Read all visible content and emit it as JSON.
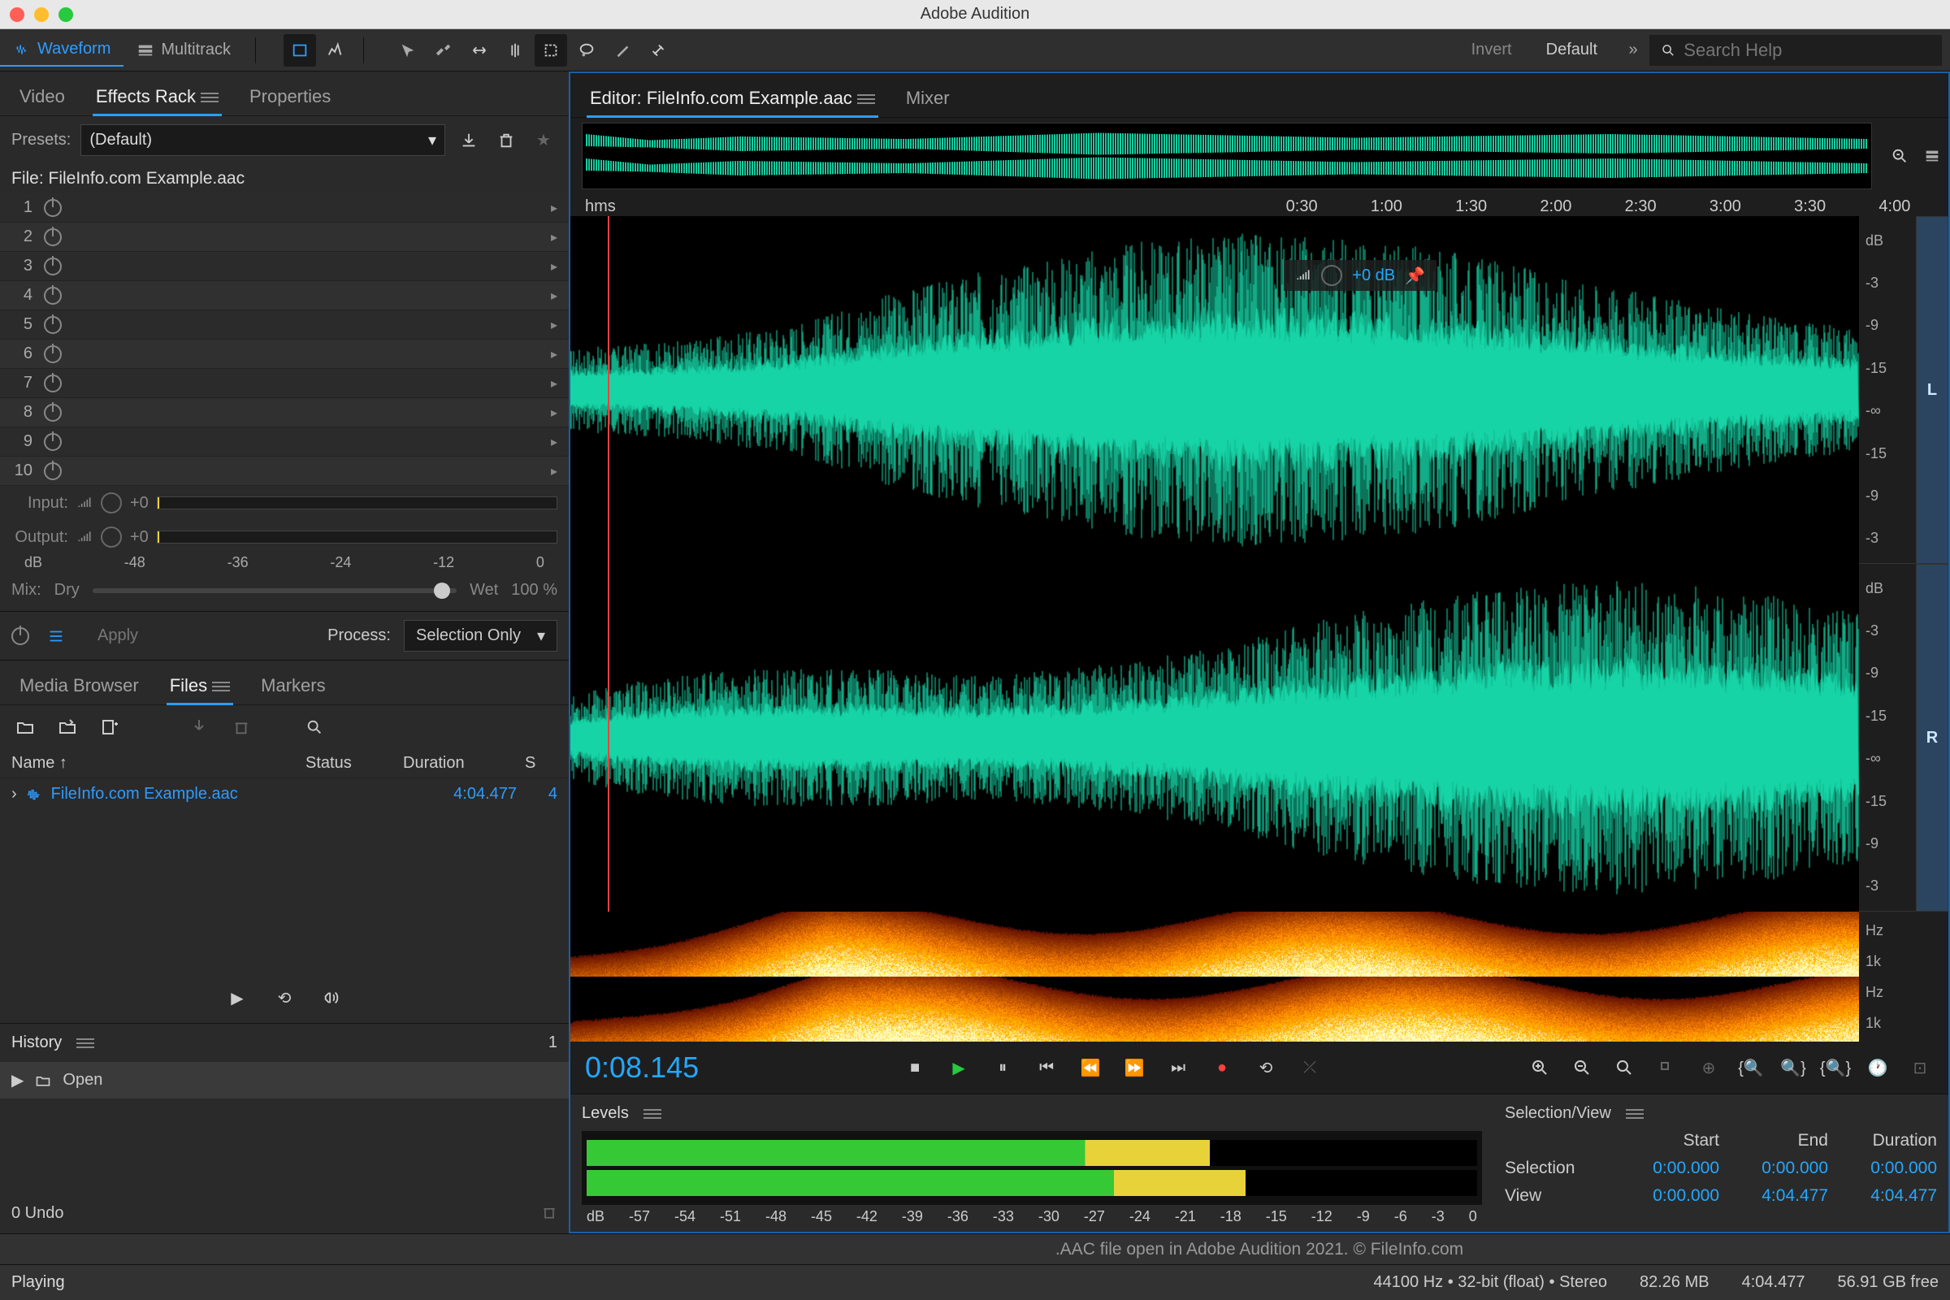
{
  "app": {
    "title": "Adobe Audition"
  },
  "modebar": {
    "waveform": "Waveform",
    "multitrack": "Multitrack",
    "invert": "Invert",
    "workspace": "Default",
    "search_placeholder": "Search Help"
  },
  "left_tabs": {
    "video": "Video",
    "effects": "Effects Rack",
    "properties": "Properties"
  },
  "fx": {
    "presets_label": "Presets:",
    "preset_value": "(Default)",
    "file_label": "File: FileInfo.com Example.aac",
    "slots": [
      1,
      2,
      3,
      4,
      5,
      6,
      7,
      8,
      9,
      10
    ],
    "input_label": "Input:",
    "output_label": "Output:",
    "gain": "+0",
    "db_ticks": [
      "dB",
      "-48",
      "-36",
      "-24",
      "-12",
      "0"
    ],
    "mix_label": "Mix:",
    "dry": "Dry",
    "wet": "Wet",
    "mix_pct": "100 %",
    "apply": "Apply",
    "process_label": "Process:",
    "process_value": "Selection Only"
  },
  "files_tabs": {
    "media": "Media Browser",
    "files": "Files",
    "markers": "Markers"
  },
  "files": {
    "cols": {
      "name": "Name",
      "status": "Status",
      "duration": "Duration",
      "s": "S"
    },
    "rows": [
      {
        "name": "FileInfo.com Example.aac",
        "duration": "4:04.477",
        "s": "4"
      }
    ]
  },
  "history": {
    "title": "History",
    "count": "1",
    "item": "Open",
    "undo": "0 Undo"
  },
  "editor_tabs": {
    "editor": "Editor: FileInfo.com Example.aac",
    "mixer": "Mixer"
  },
  "ruler": {
    "hms": "hms",
    "ticks": [
      "0:30",
      "1:00",
      "1:30",
      "2:00",
      "2:30",
      "3:00",
      "3:30",
      "4:00"
    ]
  },
  "hud": {
    "gain": "+0 dB"
  },
  "db_scale": [
    "dB",
    "-3",
    "-9",
    "-15",
    "-∞",
    "-15",
    "-9",
    "-3"
  ],
  "sp_scale": [
    "Hz",
    "1k",
    "Hz",
    "1k"
  ],
  "lr": {
    "l": "L",
    "r": "R"
  },
  "transport": {
    "timecode": "0:08.145"
  },
  "levels": {
    "title": "Levels",
    "bar1_pct": 70,
    "bar2_pct": 74,
    "ticks": [
      "dB",
      "-57",
      "-54",
      "-51",
      "-48",
      "-45",
      "-42",
      "-39",
      "-36",
      "-33",
      "-30",
      "-27",
      "-24",
      "-21",
      "-18",
      "-15",
      "-12",
      "-9",
      "-6",
      "-3",
      "0"
    ]
  },
  "selview": {
    "title": "Selection/View",
    "hdr": {
      "start": "Start",
      "end": "End",
      "duration": "Duration"
    },
    "rows": {
      "selection": {
        "label": "Selection",
        "start": "0:00.000",
        "end": "0:00.000",
        "dur": "0:00.000"
      },
      "view": {
        "label": "View",
        "start": "0:00.000",
        "end": "4:04.477",
        "dur": "4:04.477"
      }
    }
  },
  "status": {
    "caption": ".AAC file open in Adobe Audition 2021. © FileInfo.com",
    "playing": "Playing",
    "format": "44100 Hz • 32-bit (float) • Stereo",
    "ram": "82.26 MB",
    "dur": "4:04.477",
    "disk": "56.91 GB free"
  }
}
